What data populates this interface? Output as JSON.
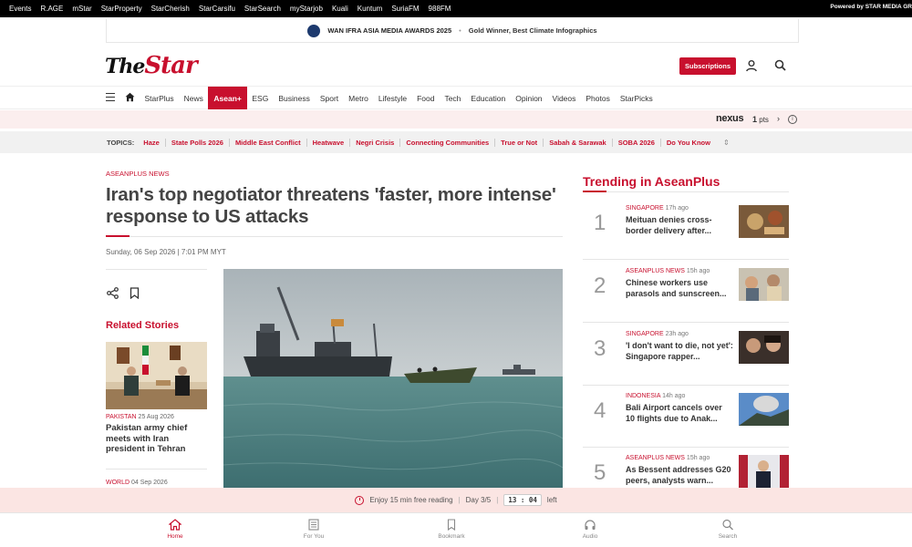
{
  "topbar": {
    "links": [
      "Events",
      "R.AGE",
      "mStar",
      "StarProperty",
      "StarCherish",
      "StarCarsifu",
      "StarSearch",
      "myStarjob",
      "Kuali",
      "Kuntum",
      "SuriaFM",
      "988FM"
    ],
    "powered": "Powered by STAR MEDIA GR"
  },
  "award": {
    "title": "WAN IFRA ASIA MEDIA AWARDS 2025",
    "subtitle": "Gold Winner, Best Climate Infographics"
  },
  "header": {
    "logo_the": "The",
    "logo_star": "Star",
    "subscribe_label": "Subscriptions"
  },
  "mainnav": {
    "items": [
      {
        "label": "StarPlus"
      },
      {
        "label": "News"
      },
      {
        "label": "Asean+",
        "active": true
      },
      {
        "label": "ESG"
      },
      {
        "label": "Business"
      },
      {
        "label": "Sport"
      },
      {
        "label": "Metro"
      },
      {
        "label": "Lifestyle"
      },
      {
        "label": "Food"
      },
      {
        "label": "Tech"
      },
      {
        "label": "Education"
      },
      {
        "label": "Opinion"
      },
      {
        "label": "Videos"
      },
      {
        "label": "Photos"
      },
      {
        "label": "StarPicks"
      }
    ]
  },
  "nexus": {
    "brand": "nexus",
    "points": "1",
    "points_unit": "pts"
  },
  "topics": {
    "label": "TOPICS:",
    "items": [
      "Haze",
      "State Polls 2026",
      "Middle East Conflict",
      "Heatwave",
      "Negri Crisis",
      "Connecting Communities",
      "True or Not",
      "Sabah & Sarawak",
      "SOBA 2026",
      "Do You Know"
    ]
  },
  "article": {
    "kicker": "ASEANPLUS NEWS",
    "headline": "Iran's top negotiator threatens 'faster, more intense' response to US attacks",
    "date": "Sunday, 06 Sep 2026 | 7:01 PM MYT"
  },
  "related": {
    "title": "Related Stories",
    "items": [
      {
        "category": "PAKISTAN",
        "date": "25 Aug 2026",
        "text": "Pakistan army chief meets with Iran president in Tehran"
      },
      {
        "category": "WORLD",
        "date": "04 Sep 2026"
      }
    ]
  },
  "trending": {
    "title": "Trending in AseanPlus",
    "items": [
      {
        "num": "1",
        "category": "SINGAPORE",
        "time": "17h ago",
        "text": "Meituan denies cross-border delivery after..."
      },
      {
        "num": "2",
        "category": "ASEANPLUS NEWS",
        "time": "15h ago",
        "text": "Chinese workers use parasols and sunscreen..."
      },
      {
        "num": "3",
        "category": "SINGAPORE",
        "time": "23h ago",
        "text": "'I don't want to die, not yet': Singapore rapper..."
      },
      {
        "num": "4",
        "category": "INDONESIA",
        "time": "14h ago",
        "text": "Bali Airport cancels over 10 flights due to Anak..."
      },
      {
        "num": "5",
        "category": "ASEANPLUS NEWS",
        "time": "15h ago",
        "text": "As Bessent addresses G20 peers, analysts warn..."
      }
    ]
  },
  "readbar": {
    "text": "Enjoy 15 min free reading",
    "day": "Day 3/5",
    "timer": "13 : 04",
    "left": "left"
  },
  "bottomnav": {
    "items": [
      {
        "label": "Home",
        "icon": "home-icon",
        "active": true
      },
      {
        "label": "For You",
        "icon": "newspaper-icon"
      },
      {
        "label": "Bookmark",
        "icon": "bookmark-icon"
      },
      {
        "label": "Audio",
        "icon": "headphones-icon"
      },
      {
        "label": "Search",
        "icon": "search-icon"
      }
    ]
  },
  "colors": {
    "brand_red": "#c8102e",
    "topbar": "#000000",
    "readbar_bg": "#fbe5e3"
  }
}
